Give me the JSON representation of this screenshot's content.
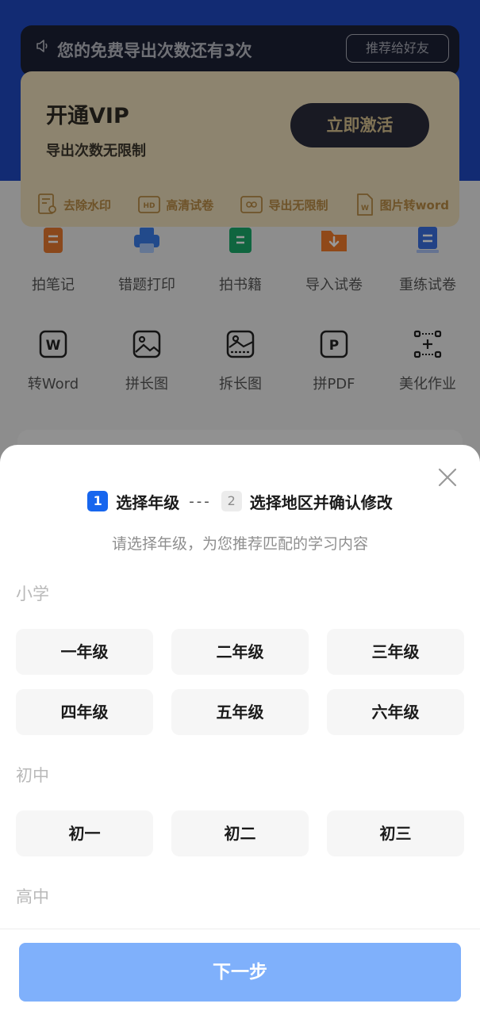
{
  "background": {
    "notice": {
      "text": "您的免费导出次数还有3次",
      "recommend_label": "推荐给好友",
      "icon": "speaker-icon"
    },
    "vip": {
      "title": "开通VIP",
      "subtitle": "导出次数无限制",
      "activate_label": "立即激活",
      "perks": [
        {
          "label": "去除水印",
          "icon": "watermark-icon"
        },
        {
          "label": "高清试卷",
          "icon": "hd-icon"
        },
        {
          "label": "导出无限制",
          "icon": "infinity-icon"
        },
        {
          "label": "图片转word",
          "icon": "word-doc-icon"
        }
      ]
    },
    "tools_row1": [
      {
        "label": "拍笔记",
        "icon": "notebook-icon",
        "color": "#e6782f"
      },
      {
        "label": "错题打印",
        "icon": "printer-icon",
        "color": "#3a7ce8"
      },
      {
        "label": "拍书籍",
        "icon": "book-icon",
        "color": "#1aa86a"
      },
      {
        "label": "导入试卷",
        "icon": "import-folder-icon",
        "color": "#f07a2a"
      },
      {
        "label": "重练试卷",
        "icon": "paper-stack-icon",
        "color": "#3a6fe0"
      }
    ],
    "tools_row2": [
      {
        "label": "转Word",
        "icon": "word-icon"
      },
      {
        "label": "拼长图",
        "icon": "image-merge-icon"
      },
      {
        "label": "拆长图",
        "icon": "image-split-icon"
      },
      {
        "label": "拼PDF",
        "icon": "pdf-icon"
      },
      {
        "label": "美化作业",
        "icon": "scan-beautify-icon"
      }
    ]
  },
  "sheet": {
    "steps": [
      {
        "num": "1",
        "label": "选择年级",
        "active": true
      },
      {
        "num": "2",
        "label": "选择地区并确认修改",
        "active": false
      }
    ],
    "step_separator": "---",
    "subtitle": "请选择年级，为您推荐匹配的学习内容",
    "sections": [
      {
        "title": "小学",
        "grades": [
          "一年级",
          "二年级",
          "三年级",
          "四年级",
          "五年级",
          "六年级"
        ]
      },
      {
        "title": "初中",
        "grades": [
          "初一",
          "初二",
          "初三"
        ]
      },
      {
        "title": "高中",
        "grades": []
      }
    ],
    "next_label": "下一步",
    "colors": {
      "primary": "#1766ee",
      "next_button": "#7fb0fb"
    }
  }
}
